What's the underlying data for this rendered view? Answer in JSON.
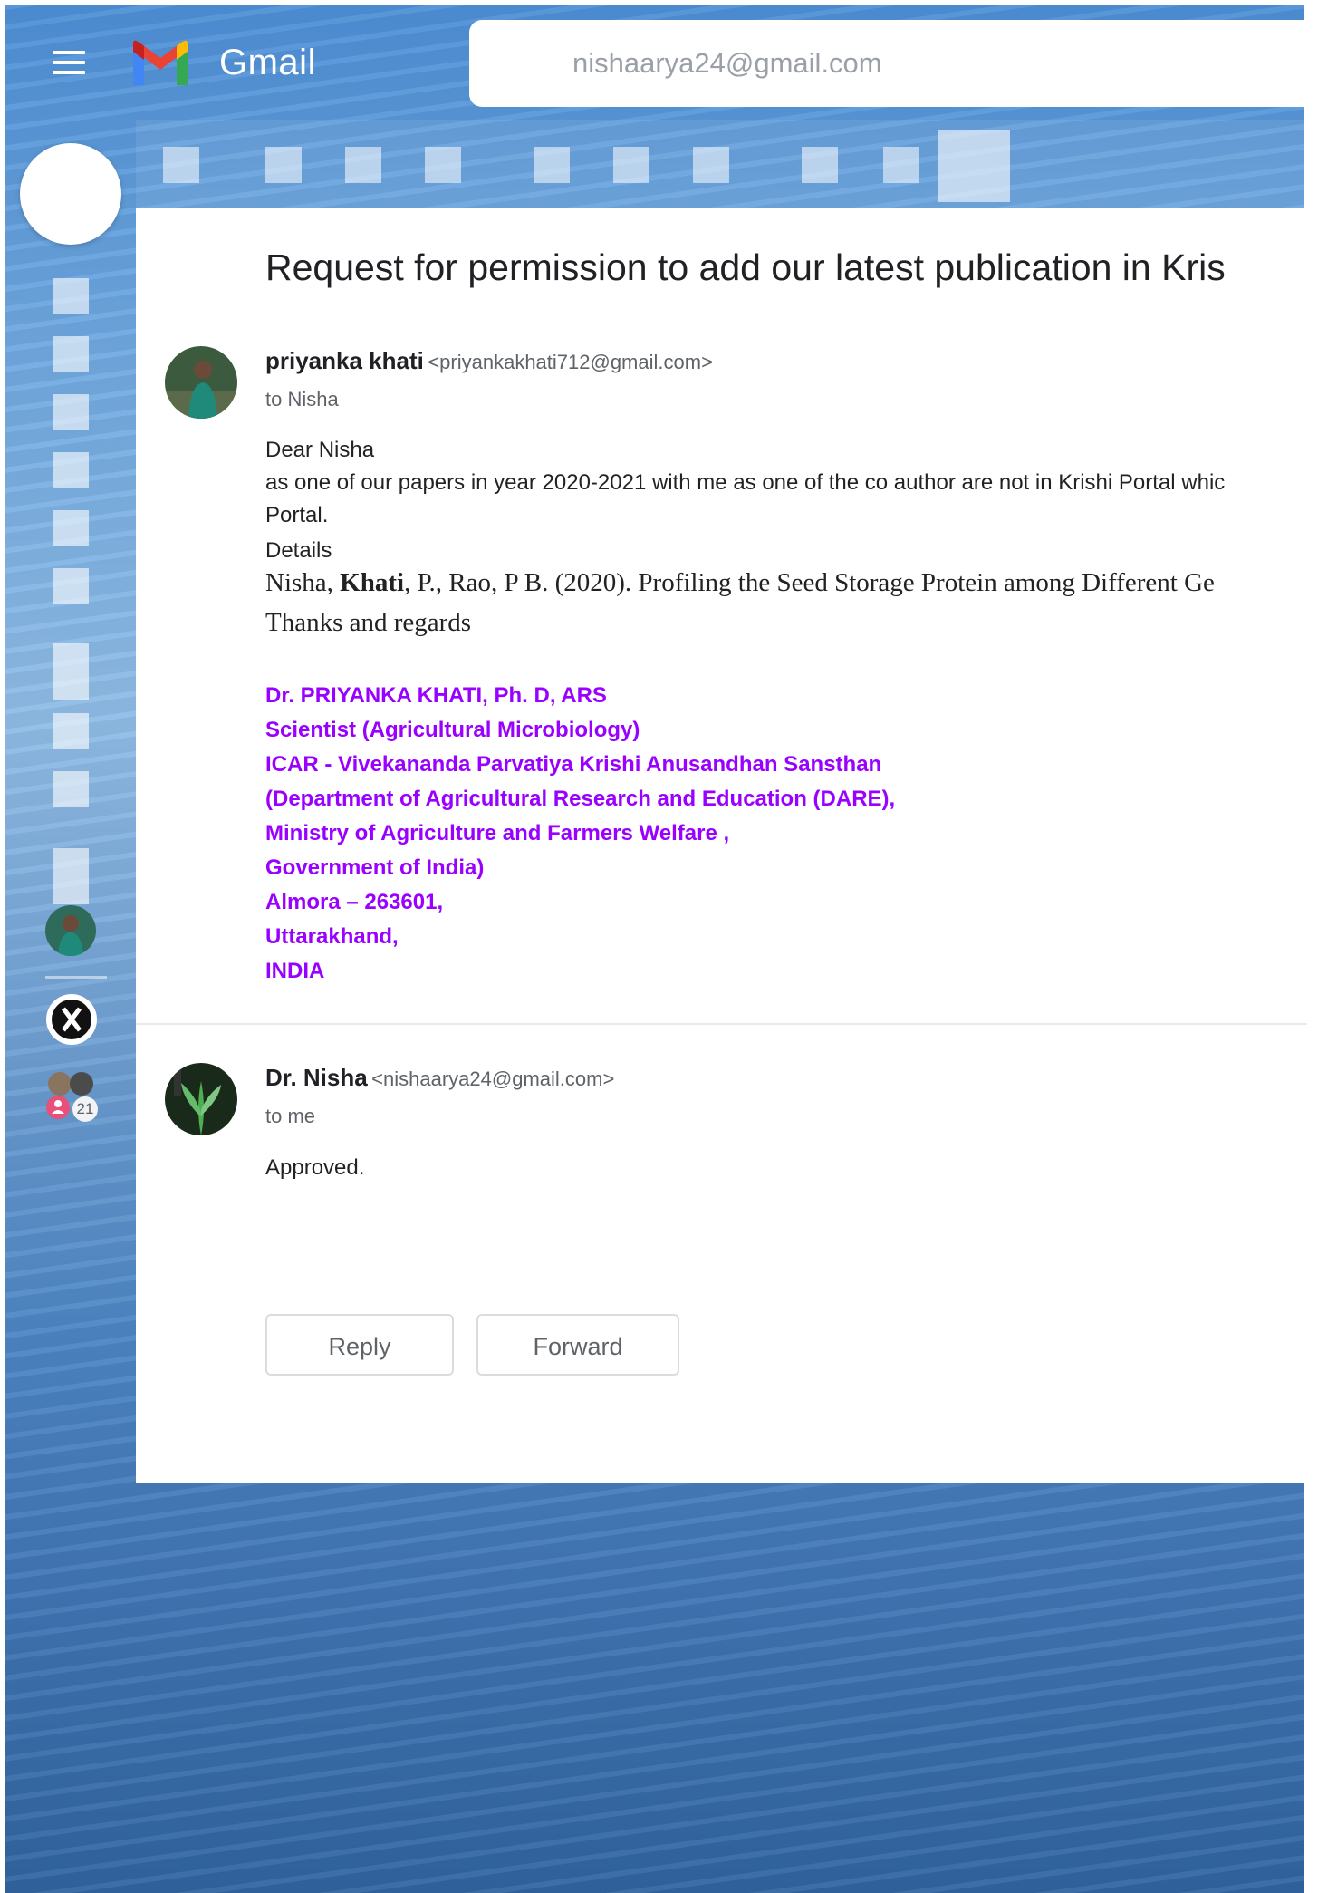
{
  "header": {
    "app_name": "Gmail",
    "search_value": "nishaarya24@gmail.com"
  },
  "thread": {
    "subject": "Request for permission to add our latest publication in Kris",
    "messages": [
      {
        "sender_name": "priyanka khati",
        "sender_email": "<priyankakhati712@gmail.com>",
        "to": "to Nisha",
        "body": {
          "greeting": "Dear Nisha",
          "line1": "as one of our papers in year 2020-2021 with me as one of the co author are not in Krishi Portal whic",
          "line2": "Portal.",
          "details_label": "Details",
          "citation_pre": "Nisha, ",
          "citation_bold": "Khati",
          "citation_post": ", P., Rao, P B. (2020). Profiling the Seed Storage Protein among Different Ge",
          "closing": "Thanks and regards"
        },
        "signature": [
          "Dr. PRIYANKA KHATI, Ph. D, ARS",
          "Scientist (Agricultural Microbiology)",
          "ICAR - Vivekananda Parvatiya Krishi Anusandhan Sansthan",
          "(Department of Agricultural Research and Education (DARE),",
          "Ministry of Agriculture and Farmers Welfare ,",
          "Government of India)",
          "Almora – 263601,",
          "Uttarakhand,",
          "INDIA"
        ]
      },
      {
        "sender_name": "Dr. Nisha",
        "sender_email": "<nishaarya24@gmail.com>",
        "to": "to me",
        "body": "Approved."
      }
    ]
  },
  "actions": {
    "reply_label": "Reply",
    "forward_label": "Forward"
  },
  "rail": {
    "group_count": "21"
  },
  "colors": {
    "signature": "#9900ff",
    "panel_bg": "#ffffff"
  }
}
